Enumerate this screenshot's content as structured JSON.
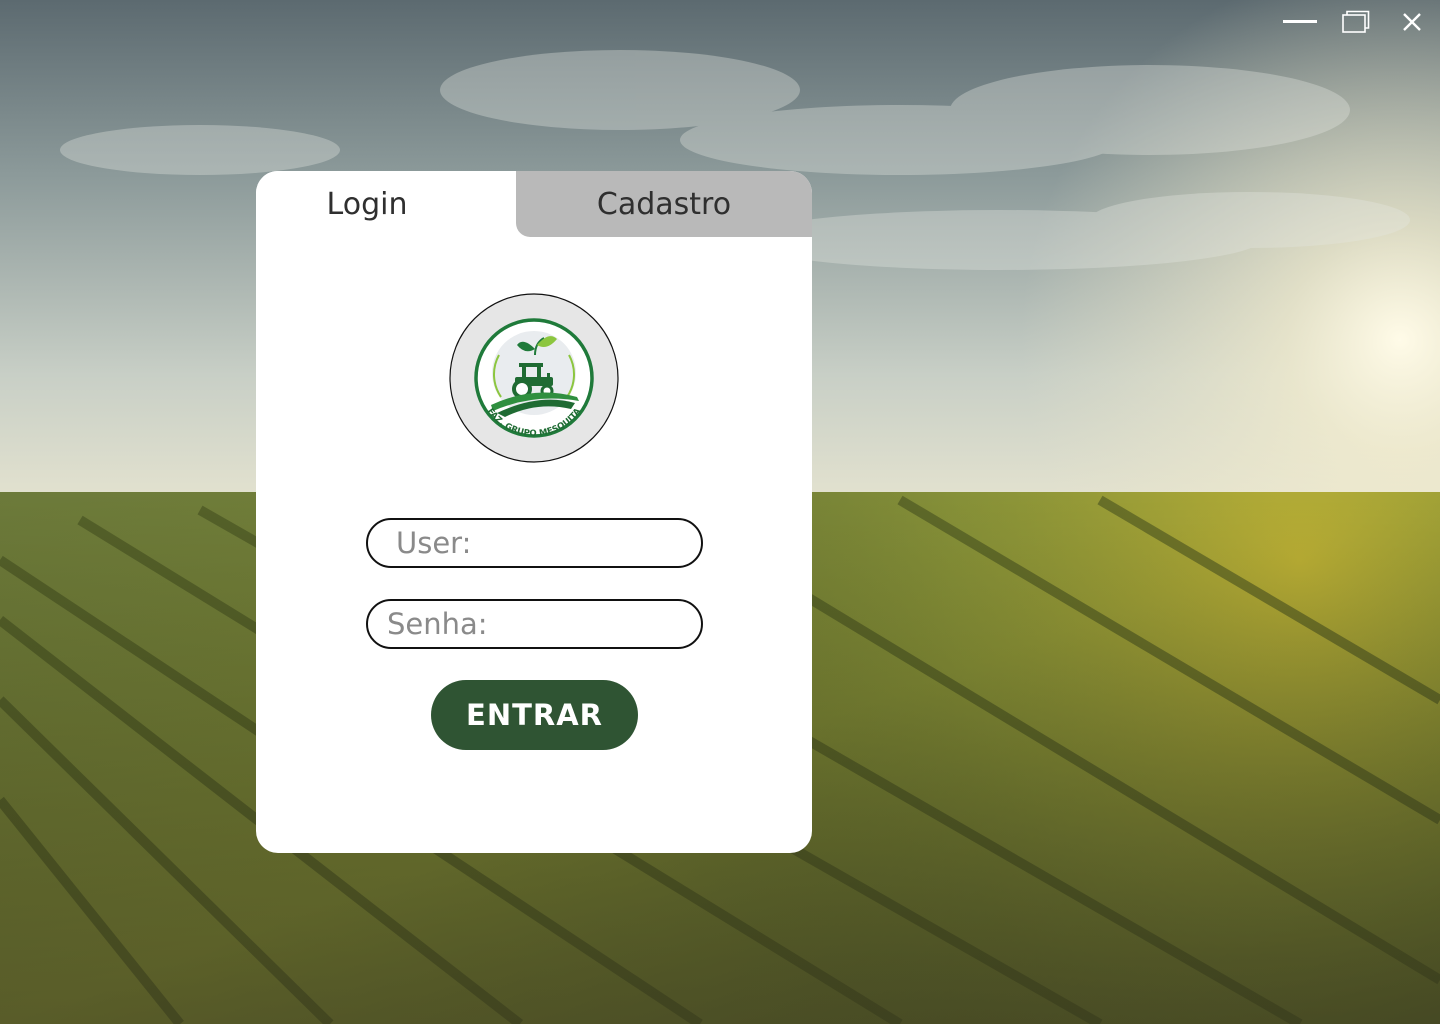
{
  "window_controls": {
    "minimize_icon": "minimize-icon",
    "restore_icon": "restore-icon",
    "close_icon": "close-icon"
  },
  "tabs": [
    {
      "label": "Login",
      "active": true
    },
    {
      "label": "Cadastro",
      "active": false
    }
  ],
  "logo": {
    "text": "FAZ. GRUPO MESQUITA",
    "icon": "tractor-icon"
  },
  "form": {
    "user_placeholder": "User:",
    "password_placeholder": "Senha:",
    "user_value": "",
    "password_value": "",
    "submit_label": "ENTRAR"
  },
  "colors": {
    "primary": "#2f5433",
    "tab_inactive": "#b9b9b9",
    "card": "#ffffff",
    "logo_green": "#1f7a3a",
    "logo_light_green": "#8cc63f"
  }
}
